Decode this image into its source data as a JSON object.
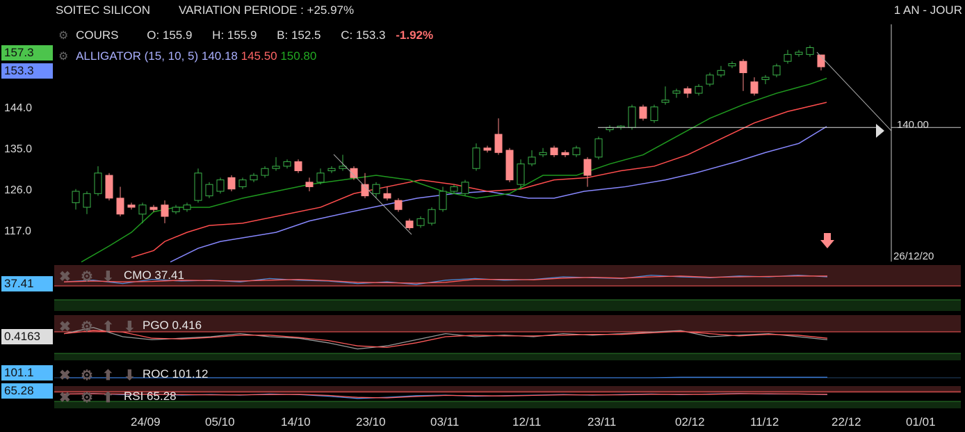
{
  "header": {
    "instrument": "SOITEC SILICON",
    "variation": "VARIATION PERIODE : +25.97%",
    "period": "1 AN - JOUR"
  },
  "cours": {
    "label": "COURS",
    "o": "O: 155.9",
    "h": "H: 155.9",
    "b": "B: 152.5",
    "c": "C: 153.3",
    "change": "-1.92%"
  },
  "alligator": {
    "label": "ALLIGATOR (15, 10, 5)",
    "jaw": "140.18",
    "teeth": "145.50",
    "lips": "150.80"
  },
  "price_tags": {
    "high": "157.3",
    "last": "153.3"
  },
  "horizontal_line": {
    "label": "140.00",
    "value": 140
  },
  "cursor_date": "26/12/20",
  "colors": {
    "up": "#3bb34a",
    "down": "#ff8a8a",
    "jaw": "#8888ff",
    "teeth": "#ff5555",
    "lips": "#22aa22",
    "tag_green": "#4cc44c",
    "tag_blue": "#6c8cff",
    "tag_cyan": "#55bbff"
  },
  "indicators": [
    {
      "label": "CMO 37.41",
      "tag": "37.41",
      "series": [
        0.2,
        0.3,
        0.1,
        0.35,
        0.25,
        0.3,
        0.2,
        0.4,
        0.3,
        0.25,
        0.1,
        0.2,
        0.05,
        0.3,
        0.4,
        0.3,
        0.35,
        0.5,
        0.45,
        0.4,
        0.6,
        0.5,
        0.45,
        0.55,
        0.5,
        0.6,
        0.5
      ]
    },
    {
      "label": "PGO 0.416",
      "tag": "0.4163",
      "series": [
        0.6,
        0.8,
        0.5,
        0.4,
        0.45,
        0.5,
        0.6,
        0.5,
        0.45,
        0.3,
        0.1,
        0.2,
        0.4,
        0.6,
        0.5,
        0.55,
        0.5,
        0.6,
        0.55,
        0.6,
        0.65,
        0.7,
        0.5,
        0.55,
        0.6,
        0.5,
        0.4
      ]
    },
    {
      "label": "ROC 101.12",
      "tag": "101.1",
      "series": [
        0.5,
        0.5,
        0.5,
        0.5,
        0.5,
        0.5,
        0.5,
        0.5,
        0.5,
        0.5,
        0.5,
        0.5,
        0.5,
        0.5,
        0.5,
        0.5,
        0.5,
        0.5,
        0.5,
        0.5,
        0.5,
        0.55,
        0.55,
        0.55,
        0.55,
        0.55,
        0.55
      ]
    },
    {
      "label": "RSI 65.28",
      "tag": "65.28",
      "series": [
        0.6,
        0.65,
        0.55,
        0.6,
        0.5,
        0.55,
        0.5,
        0.6,
        0.55,
        0.4,
        0.2,
        0.3,
        0.45,
        0.5,
        0.4,
        0.45,
        0.5,
        0.55,
        0.5,
        0.55,
        0.6,
        0.55,
        0.6,
        0.65,
        0.6,
        0.6,
        0.55
      ]
    }
  ],
  "chart_data": {
    "type": "candlestick",
    "title": "SOITEC SILICON",
    "y_ticks": [
      117.0,
      126.0,
      135.0,
      144.0
    ],
    "y_tick_labels": [
      "117.0",
      "126.0",
      "135.0",
      "144.0"
    ],
    "x_tick_labels": [
      "24/09",
      "05/10",
      "14/10",
      "23/10",
      "03/11",
      "12/11",
      "23/11",
      "02/12",
      "11/12",
      "22/12",
      "01/01"
    ],
    "candles": [
      [
        123.5,
        126.5,
        122,
        126
      ],
      [
        122.5,
        126,
        121,
        125.5
      ],
      [
        125.5,
        131.5,
        125,
        130
      ],
      [
        129.5,
        130,
        124,
        124.5
      ],
      [
        124.5,
        127,
        120.5,
        121
      ],
      [
        123,
        123.5,
        122,
        122.5
      ],
      [
        121,
        123.5,
        119,
        123
      ],
      [
        122.5,
        123,
        121.5,
        122
      ],
      [
        123,
        124,
        119,
        120.5
      ],
      [
        121.5,
        123,
        121,
        122.5
      ],
      [
        122,
        123.5,
        121.5,
        123
      ],
      [
        124,
        131,
        123.5,
        130
      ],
      [
        125,
        128,
        124.5,
        127.5
      ],
      [
        126,
        129,
        125.5,
        128.5
      ],
      [
        129,
        129.5,
        126,
        126.5
      ],
      [
        127,
        129,
        126.5,
        128.5
      ],
      [
        128.5,
        130,
        128,
        129.5
      ],
      [
        129.5,
        131.5,
        129,
        131
      ],
      [
        131,
        133.5,
        130.5,
        131.5
      ],
      [
        131.5,
        133,
        131,
        132.5
      ],
      [
        132.5,
        133,
        130,
        130.5
      ],
      [
        128,
        129,
        126,
        127
      ],
      [
        128,
        131,
        127.5,
        130
      ],
      [
        130.5,
        131.5,
        130,
        131
      ],
      [
        131,
        134,
        130.5,
        131.5
      ],
      [
        131,
        131.5,
        128.5,
        129
      ],
      [
        127.5,
        130,
        124.5,
        125
      ],
      [
        125.5,
        128,
        124.5,
        127.5
      ],
      [
        125.5,
        127,
        124,
        124.5
      ],
      [
        124,
        124.5,
        121.5,
        122
      ],
      [
        119.5,
        120,
        117.5,
        118
      ],
      [
        118.5,
        120.5,
        118,
        120
      ],
      [
        119,
        122.5,
        118.5,
        122
      ],
      [
        122,
        127,
        121.5,
        126
      ],
      [
        126,
        127.5,
        125.5,
        127
      ],
      [
        125.5,
        128.5,
        125,
        128
      ],
      [
        131,
        136.5,
        130.5,
        135.5
      ],
      [
        135.5,
        136,
        134.5,
        135
      ],
      [
        138.5,
        142,
        134,
        134.5
      ],
      [
        135,
        135.5,
        128,
        128.5
      ],
      [
        127.5,
        133,
        126.5,
        132
      ],
      [
        132,
        135,
        131.5,
        133.5
      ],
      [
        134,
        135.5,
        133.5,
        134.5
      ],
      [
        135.5,
        136,
        133.5,
        134
      ],
      [
        134.5,
        135,
        133.5,
        134
      ],
      [
        134,
        136,
        133.5,
        135.5
      ],
      [
        133,
        133.5,
        127,
        129.5
      ],
      [
        133.5,
        138,
        133,
        137.5
      ],
      [
        139.5,
        140.5,
        139,
        140
      ],
      [
        140,
        140.5,
        139.5,
        140.3
      ],
      [
        140,
        145,
        139.5,
        144.5
      ],
      [
        144.5,
        145,
        141.5,
        142
      ],
      [
        141.5,
        145,
        141,
        144.5
      ],
      [
        145.5,
        149,
        145,
        146
      ],
      [
        147.5,
        148.5,
        146.5,
        148
      ],
      [
        148.5,
        149,
        146.5,
        147.5
      ],
      [
        147.5,
        149.5,
        147,
        149
      ],
      [
        149.5,
        152,
        149,
        151.5
      ],
      [
        151.5,
        153.5,
        151,
        152.5
      ],
      [
        153.5,
        154.5,
        153,
        154
      ],
      [
        154.5,
        155,
        148,
        152
      ],
      [
        150,
        151,
        147,
        147.5
      ],
      [
        150.5,
        151.5,
        149.5,
        151
      ],
      [
        151.5,
        154,
        151,
        153.5
      ],
      [
        154.5,
        157,
        154,
        156
      ],
      [
        156,
        157,
        155.5,
        156.5
      ],
      [
        156,
        158,
        155.5,
        157.5
      ],
      [
        155.9,
        155.9,
        152.5,
        153.3
      ]
    ],
    "series": [
      {
        "name": "jaw",
        "points": [
          [
            8.5,
            110.5
          ],
          [
            11,
            113.5
          ],
          [
            13,
            115
          ],
          [
            18,
            117
          ],
          [
            21,
            119.5
          ],
          [
            25.7,
            122
          ],
          [
            30.7,
            124.5
          ],
          [
            34,
            125.5
          ],
          [
            37,
            126
          ],
          [
            40.7,
            124.5
          ],
          [
            43,
            124.5
          ],
          [
            45.7,
            126
          ],
          [
            49.4,
            127
          ],
          [
            53,
            128.5
          ],
          [
            55.7,
            130
          ],
          [
            59.4,
            132.5
          ],
          [
            62,
            134.5
          ],
          [
            65,
            136.5
          ],
          [
            67.5,
            140.2
          ]
        ]
      },
      {
        "name": "teeth",
        "points": [
          [
            5,
            111.5
          ],
          [
            7,
            113
          ],
          [
            8,
            115
          ],
          [
            10,
            117
          ],
          [
            12,
            118.5
          ],
          [
            15,
            119
          ],
          [
            19,
            121
          ],
          [
            22,
            122.5
          ],
          [
            25,
            125.5
          ],
          [
            28,
            127
          ],
          [
            31,
            128.5
          ],
          [
            34,
            127.5
          ],
          [
            37,
            126
          ],
          [
            40,
            126.5
          ],
          [
            43,
            128.5
          ],
          [
            46,
            129
          ],
          [
            49,
            130.5
          ],
          [
            52,
            131.5
          ],
          [
            55,
            134
          ],
          [
            58,
            137.5
          ],
          [
            61,
            141
          ],
          [
            64,
            143.5
          ],
          [
            67.5,
            145.5
          ]
        ]
      },
      {
        "name": "lips",
        "points": [
          [
            0.5,
            110.5
          ],
          [
            3,
            114
          ],
          [
            5,
            117
          ],
          [
            7,
            121.5
          ],
          [
            9,
            122.5
          ],
          [
            12,
            122.5
          ],
          [
            15,
            124.5
          ],
          [
            18,
            126
          ],
          [
            21,
            127.5
          ],
          [
            24,
            128.5
          ],
          [
            27,
            129.5
          ],
          [
            30,
            128.5
          ],
          [
            33,
            126
          ],
          [
            36,
            124.5
          ],
          [
            39,
            125.5
          ],
          [
            42,
            129.5
          ],
          [
            45,
            129.5
          ],
          [
            48,
            132
          ],
          [
            51,
            134
          ],
          [
            54,
            138
          ],
          [
            57,
            142
          ],
          [
            60,
            145
          ],
          [
            63,
            147.5
          ],
          [
            66,
            149.5
          ],
          [
            67.5,
            150.8
          ]
        ]
      }
    ]
  }
}
